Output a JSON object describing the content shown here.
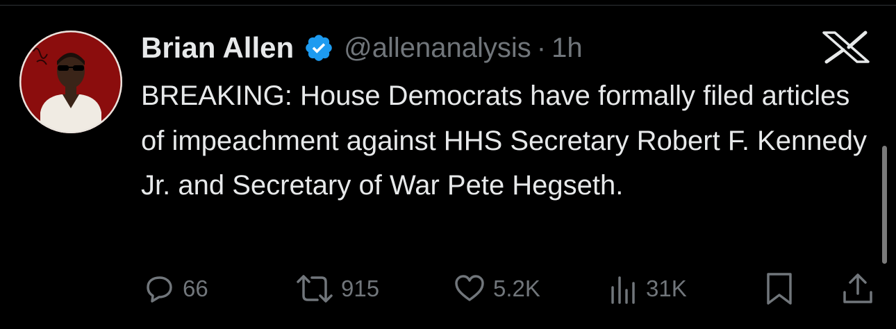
{
  "tweet": {
    "author": {
      "display_name": "Brian Allen",
      "handle": "@allenanalysis",
      "verified": true,
      "verified_color": "#1d9bf0"
    },
    "separator": "·",
    "time": "1h",
    "text": "BREAKING: House Democrats have formally filed articles of impeachment against HHS Secretary Robert F. Kennedy Jr. and Secretary of War Pete Hegseth.",
    "platform_icon": "x-logo-icon"
  },
  "actions": {
    "replies": "66",
    "reposts": "915",
    "likes": "5.2K",
    "views": "31K",
    "icons": [
      "reply-icon",
      "repost-icon",
      "like-icon",
      "views-icon",
      "bookmark-icon",
      "share-icon"
    ]
  },
  "colors": {
    "background": "#000000",
    "text_primary": "#e7e9ea",
    "text_secondary": "#71767b",
    "divider": "#2f3336"
  }
}
